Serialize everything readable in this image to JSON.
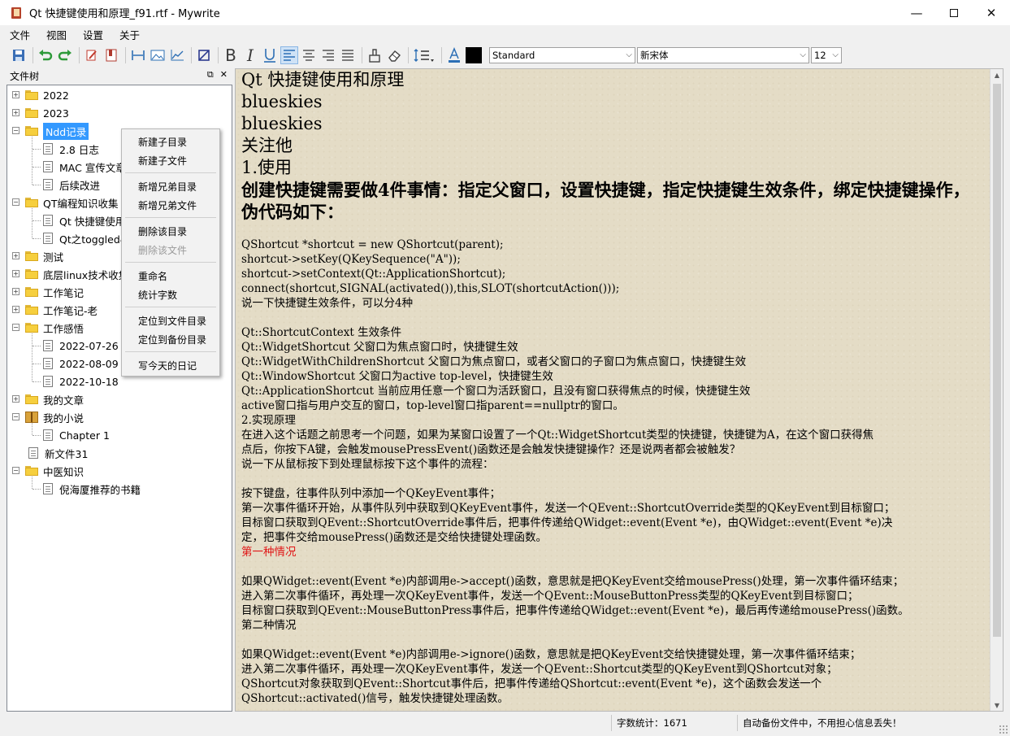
{
  "window": {
    "title": "Qt 快捷键使用和原理_f91.rtf - Mywrite",
    "controls": [
      "minimize-icon",
      "maximize-icon",
      "close-icon"
    ]
  },
  "menubar": {
    "items": [
      "文件",
      "视图",
      "设置",
      "关于"
    ]
  },
  "toolbar": {
    "style_combo": "Standard",
    "font_combo": "新宋体",
    "size_combo": "12",
    "icons": [
      "save-icon",
      "undo-icon",
      "redo-icon",
      "edit-icon",
      "bookmark-icon",
      "width-icon",
      "image-icon",
      "chart-icon",
      "crop-icon",
      "bold-icon",
      "italic-icon",
      "underline-icon",
      "align-left-icon",
      "align-center-icon",
      "align-right-icon",
      "align-justify-icon",
      "format-painter-icon",
      "eraser-icon",
      "line-spacing-icon",
      "font-color-icon",
      "highlight-color-icon"
    ],
    "font_color": "#000000"
  },
  "dock": {
    "title": "文件树",
    "float_icon": "⧉",
    "close_icon": "✕"
  },
  "tree": [
    {
      "label": "2022",
      "type": "folder",
      "expander": "+"
    },
    {
      "label": "2023",
      "type": "folder",
      "expander": "+"
    },
    {
      "label": "Ndd记录",
      "type": "folder",
      "expander": "−",
      "selected": true
    },
    {
      "label": "2.8 日志",
      "type": "doc"
    },
    {
      "label": "MAC 宣传文章",
      "type": "doc"
    },
    {
      "label": "后续改进",
      "type": "doc"
    },
    {
      "label": "QT编程知识收集",
      "type": "folder",
      "expander": "−"
    },
    {
      "label": "Qt 快捷键使用",
      "type": "doc"
    },
    {
      "label": "Qt之toggled&",
      "type": "doc"
    },
    {
      "label": "测试",
      "type": "folder",
      "expander": "+"
    },
    {
      "label": "底层linux技术收集",
      "type": "folder",
      "expander": "+"
    },
    {
      "label": "工作笔记",
      "type": "folder",
      "expander": "+"
    },
    {
      "label": "工作笔记-老",
      "type": "folder",
      "expander": "+"
    },
    {
      "label": "工作感悟",
      "type": "folder",
      "expander": "−"
    },
    {
      "label": "2022-07-26",
      "type": "doc"
    },
    {
      "label": "2022-08-09",
      "type": "doc"
    },
    {
      "label": "2022-10-18",
      "type": "doc"
    },
    {
      "label": "我的文章",
      "type": "folder",
      "expander": "+"
    },
    {
      "label": "我的小说",
      "type": "novel",
      "expander": "−"
    },
    {
      "label": "Chapter 1",
      "type": "doc"
    },
    {
      "label": "新文件31",
      "type": "doc"
    },
    {
      "label": "中医知识",
      "type": "folder",
      "expander": "−"
    },
    {
      "label": "倪海厦推荐的书籍",
      "type": "doc"
    }
  ],
  "context_menu": {
    "items": [
      {
        "label": "新建子目录",
        "disabled": false
      },
      {
        "label": "新建子文件",
        "disabled": false
      },
      {
        "label": "新增兄弟目录",
        "disabled": false
      },
      {
        "label": "新增兄弟文件",
        "disabled": false
      },
      {
        "label": "删除该目录",
        "disabled": false
      },
      {
        "label": "删除该文件",
        "disabled": true
      },
      {
        "label": "重命名",
        "disabled": false
      },
      {
        "label": "统计字数",
        "disabled": false
      },
      {
        "label": "定位到文件目录",
        "disabled": false
      },
      {
        "label": "定位到备份目录",
        "disabled": false
      },
      {
        "label": "写今天的日记",
        "disabled": false
      }
    ]
  },
  "editor": {
    "lines": [
      {
        "text": "Qt 快捷键使用和原理",
        "style": "big"
      },
      {
        "text": "blueskies",
        "style": "big"
      },
      {
        "text": "blueskies",
        "style": "big"
      },
      {
        "text": "关注他",
        "style": "big"
      },
      {
        "text": "1.使用",
        "style": "big"
      },
      {
        "text": "创建快捷键需要做4件事情：指定父窗口，设置快捷键，指定快捷键生效条件，绑定快捷键操作，伪代码如下：",
        "style": "bold"
      },
      {
        "text": "",
        "style": "normal"
      },
      {
        "text": "QShortcut *shortcut = new QShortcut(parent);",
        "style": "normal"
      },
      {
        "text": "shortcut->setKey(QKeySequence(\"A\"));",
        "style": "normal"
      },
      {
        "text": "shortcut->setContext(Qt::ApplicationShortcut);",
        "style": "normal"
      },
      {
        "text": "connect(shortcut,SIGNAL(activated()),this,SLOT(shortcutAction()));",
        "style": "normal"
      },
      {
        "text": "说一下快捷键生效条件，可以分4种",
        "style": "normal"
      },
      {
        "text": "",
        "style": "normal"
      },
      {
        "text": "Qt::ShortcutContext 生效条件",
        "style": "normal"
      },
      {
        "text": "Qt::WidgetShortcut  父窗口为焦点窗口时，快捷键生效",
        "style": "normal"
      },
      {
        "text": "Qt::WidgetWithChildrenShortcut          父窗口为焦点窗口，或者父窗口的子窗口为焦点窗口，快捷键生效",
        "style": "normal"
      },
      {
        "text": "Qt::WindowShortcut  父窗口为active top-level，快捷键生效",
        "style": "normal"
      },
      {
        "text": "Qt::ApplicationShortcut       当前应用任意一个窗口为活跃窗口，且没有窗口获得焦点的时候，快捷键生效",
        "style": "normal"
      },
      {
        "text": "active窗口指与用户交互的窗口，top-level窗口指parent==nullptr的窗口。",
        "style": "normal"
      },
      {
        "text": "2.实现原理",
        "style": "normal"
      },
      {
        "text": "在进入这个话题之前思考一个问题，如果为某窗口设置了一个Qt::WidgetShortcut类型的快捷键，快捷键为A，在这个窗口获得焦",
        "style": "normal"
      },
      {
        "text": "点后，你按下A键，会触发mousePressEvent()函数还是会触发快捷键操作？还是说两者都会被触发？",
        "style": "normal"
      },
      {
        "text": "说一下从鼠标按下到处理鼠标按下这个事件的流程：",
        "style": "normal"
      },
      {
        "text": "",
        "style": "normal"
      },
      {
        "text": "按下键盘，往事件队列中添加一个QKeyEvent事件；",
        "style": "normal"
      },
      {
        "text": "第一次事件循环开始，从事件队列中获取到QKeyEvent事件，发送一个QEvent::ShortcutOverride类型的QKeyEvent到目标窗口；",
        "style": "normal"
      },
      {
        "text": "目标窗口获取到QEvent::ShortcutOverride事件后，把事件传递给QWidget::event(Event *e)，由QWidget::event(Event *e)决",
        "style": "normal"
      },
      {
        "text": "定，把事件交给mousePress()函数还是交给快捷键处理函数。",
        "style": "normal"
      },
      {
        "text": "第一种情况",
        "style": "red"
      },
      {
        "text": "",
        "style": "normal"
      },
      {
        "text": "如果QWidget::event(Event *e)内部调用e->accept()函数，意思就是把QKeyEvent交给mousePress()处理，第一次事件循环结束；",
        "style": "normal"
      },
      {
        "text": "进入第二次事件循环，再处理一次QKeyEvent事件，发送一个QEvent::MouseButtonPress类型的QKeyEvent到目标窗口；",
        "style": "normal"
      },
      {
        "text": "目标窗口获取到QEvent::MouseButtonPress事件后，把事件传递给QWidget::event(Event *e)，最后再传递给mousePress()函数。",
        "style": "normal"
      },
      {
        "text": "第二种情况",
        "style": "normal"
      },
      {
        "text": "",
        "style": "normal"
      },
      {
        "text": "如果QWidget::event(Event *e)内部调用e->ignore()函数，意思就是把QKeyEvent交给快捷键处理，第一次事件循环结束；",
        "style": "normal"
      },
      {
        "text": "进入第二次事件循环，再处理一次QKeyEvent事件，发送一个QEvent::Shortcut类型的QKeyEvent到QShortcut对象；",
        "style": "normal"
      },
      {
        "text": "QShortcut对象获取到QEvent::Shortcut事件后，把事件传递给QShortcut::event(Event *e)，这个函数会发送一个",
        "style": "normal"
      },
      {
        "text": "QShortcut::activated()信号，触发快捷键处理函数。",
        "style": "normal"
      }
    ]
  },
  "statusbar": {
    "word_count": "字数统计：1671",
    "backup_msg": "自动备份文件中，不用担心信息丢失！"
  }
}
